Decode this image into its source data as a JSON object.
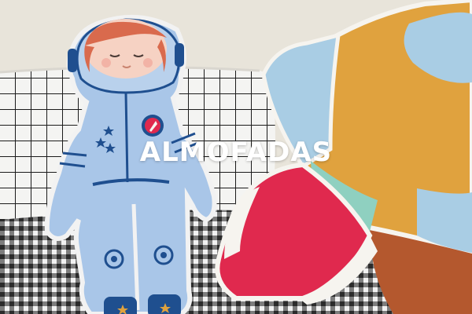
{
  "banner": {
    "title": "ALMOFADAS"
  },
  "colors": {
    "wall": "#e8e4da",
    "astronaut_suit": "#a9c6e8",
    "suit_trim": "#1f4f8f",
    "star_mustard": "#e0a23e",
    "star_light_blue": "#a9cde4",
    "rocket_red": "#e0294e",
    "gingham_dark": "#2b2b2b",
    "title_text": "#ffffff"
  }
}
